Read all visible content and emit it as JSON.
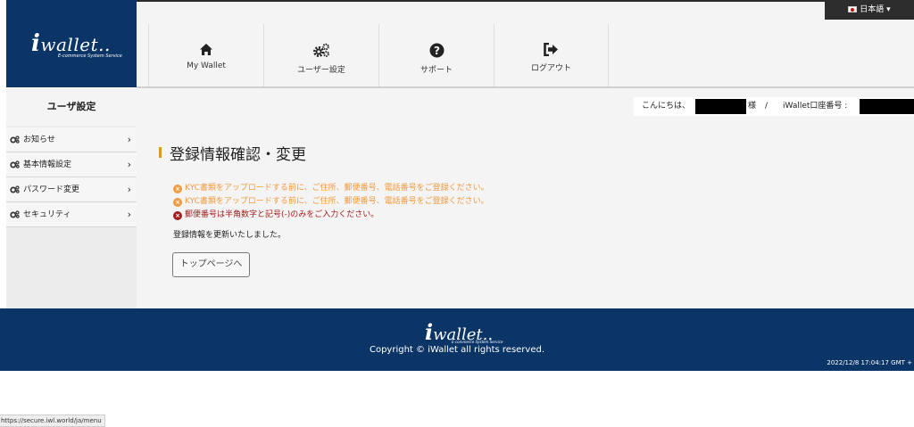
{
  "brand": {
    "name": "wallet..",
    "prefix": "i",
    "tagline": "E-commerce System Service"
  },
  "language": {
    "selected": "日本語"
  },
  "nav": [
    {
      "label": "My Wallet",
      "icon": "home-icon"
    },
    {
      "label": "ユーザー設定",
      "icon": "gears-icon"
    },
    {
      "label": "サポート",
      "icon": "question-circle-icon"
    },
    {
      "label": "ログアウト",
      "icon": "sign-out-icon"
    }
  ],
  "greeting": {
    "hello": "こんにちは、",
    "honorific": "様",
    "separator": "/",
    "account_label": "iWallet口座番号 :"
  },
  "sidebar": {
    "title": "ユーザ設定",
    "items": [
      {
        "label": "お知らせ"
      },
      {
        "label": "基本情報設定"
      },
      {
        "label": "パスワード変更"
      },
      {
        "label": "セキュリティ"
      }
    ],
    "chevron": "›"
  },
  "main": {
    "title": "登録情報確認・変更",
    "warnings": [
      "KYC書類をアップロードする前に、ご住所、郵便番号、電話番号をご登録ください。",
      "KYC書類をアップロードする前に、ご住所、郵便番号、電話番号をご登録ください。"
    ],
    "error": "郵便番号は半角数字と記号(-)のみをご入力ください。",
    "success": "登録情報を更新いたしました。",
    "top_button": "トップページへ"
  },
  "footer": {
    "copyright": "Copyright © iWallet all rights reserved.",
    "timestamp": "2022/12/8 17:04:17 GMT +"
  },
  "status_url": "https://secure.iwl.world/ja/menu",
  "colors": {
    "brand_navy": "#0b3567",
    "warning": "#f29a3d",
    "error": "#a31d1d",
    "accent": "#d79a24"
  }
}
